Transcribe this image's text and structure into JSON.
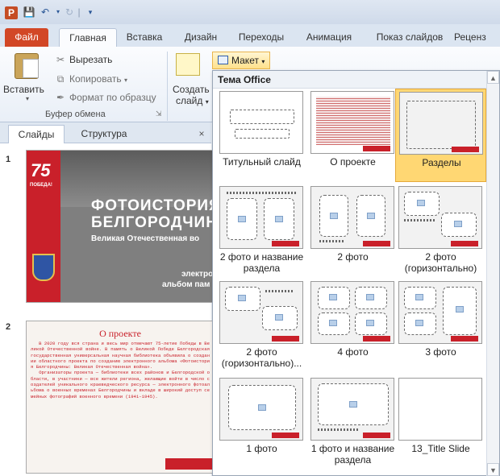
{
  "titlebar": {
    "app_icon": "P"
  },
  "ribbon_tabs": [
    "Файл",
    "Главная",
    "Вставка",
    "Дизайн",
    "Переходы",
    "Анимация",
    "Показ слайдов",
    "Реценз"
  ],
  "clipboard": {
    "paste": "Вставить",
    "cut": "Вырезать",
    "copy": "Копировать",
    "format_painter": "Формат по образцу",
    "group": "Буфер обмена"
  },
  "slides_group": {
    "create_1": "Создать",
    "create_2": "слайд"
  },
  "layout_button": "Макет",
  "font_size": "16",
  "panel_tabs": [
    "Слайды",
    "Структура"
  ],
  "slides": [
    {
      "num": "1",
      "badge": "75",
      "badge_sub": "ПОБЕДА!",
      "title_1": "ФОТОИСТОРИЯ",
      "title_2": "БЕЛГОРОДЧИНЫ",
      "subtitle": "Великая Отечественная во",
      "line_2": "электронн",
      "line_3": "альбом пам"
    },
    {
      "num": "2",
      "title": "О проекте",
      "body": "   В 2020 году вся страна и весь мир отмечают 75-летие Победы в Великой Отечественной войне. В память о Великой Победе Белгородская государственная универсальная научная библиотека объявила о создании областного проекта по созданию электронного альбома «Фотоистория Белгородчины: Великая Отечественная война».\n   Организаторы проекта — библиотеки всех районов и Белгородской области, в участники — все жители региона, желающие войти в число создателей уникального краеведческого ресурса — электронного фотоальбома о военных временах Белгородчины и вкладе в широкий доступ семейных фотографий военного времени (1941–1945)."
    }
  ],
  "gallery": {
    "heading": "Тема Office",
    "layouts": [
      {
        "label": "Титульный слайд",
        "selected": false
      },
      {
        "label": "О проекте",
        "selected": false
      },
      {
        "label": "Разделы",
        "selected": true
      },
      {
        "label": "2 фото и название раздела",
        "selected": false
      },
      {
        "label": "2 фото",
        "selected": false
      },
      {
        "label": "2 фото (горизонтально)",
        "selected": false
      },
      {
        "label": "2 фото (горизонтально)...",
        "selected": false
      },
      {
        "label": "4 фото",
        "selected": false
      },
      {
        "label": "3 фото",
        "selected": false
      },
      {
        "label": "1 фото",
        "selected": false
      },
      {
        "label": "1 фото и название раздела",
        "selected": false
      },
      {
        "label": "13_Title Slide",
        "selected": false
      }
    ]
  },
  "colors": {
    "accent_red": "#c9202a",
    "file_tab": "#d24726",
    "selection": "#ffd773"
  }
}
